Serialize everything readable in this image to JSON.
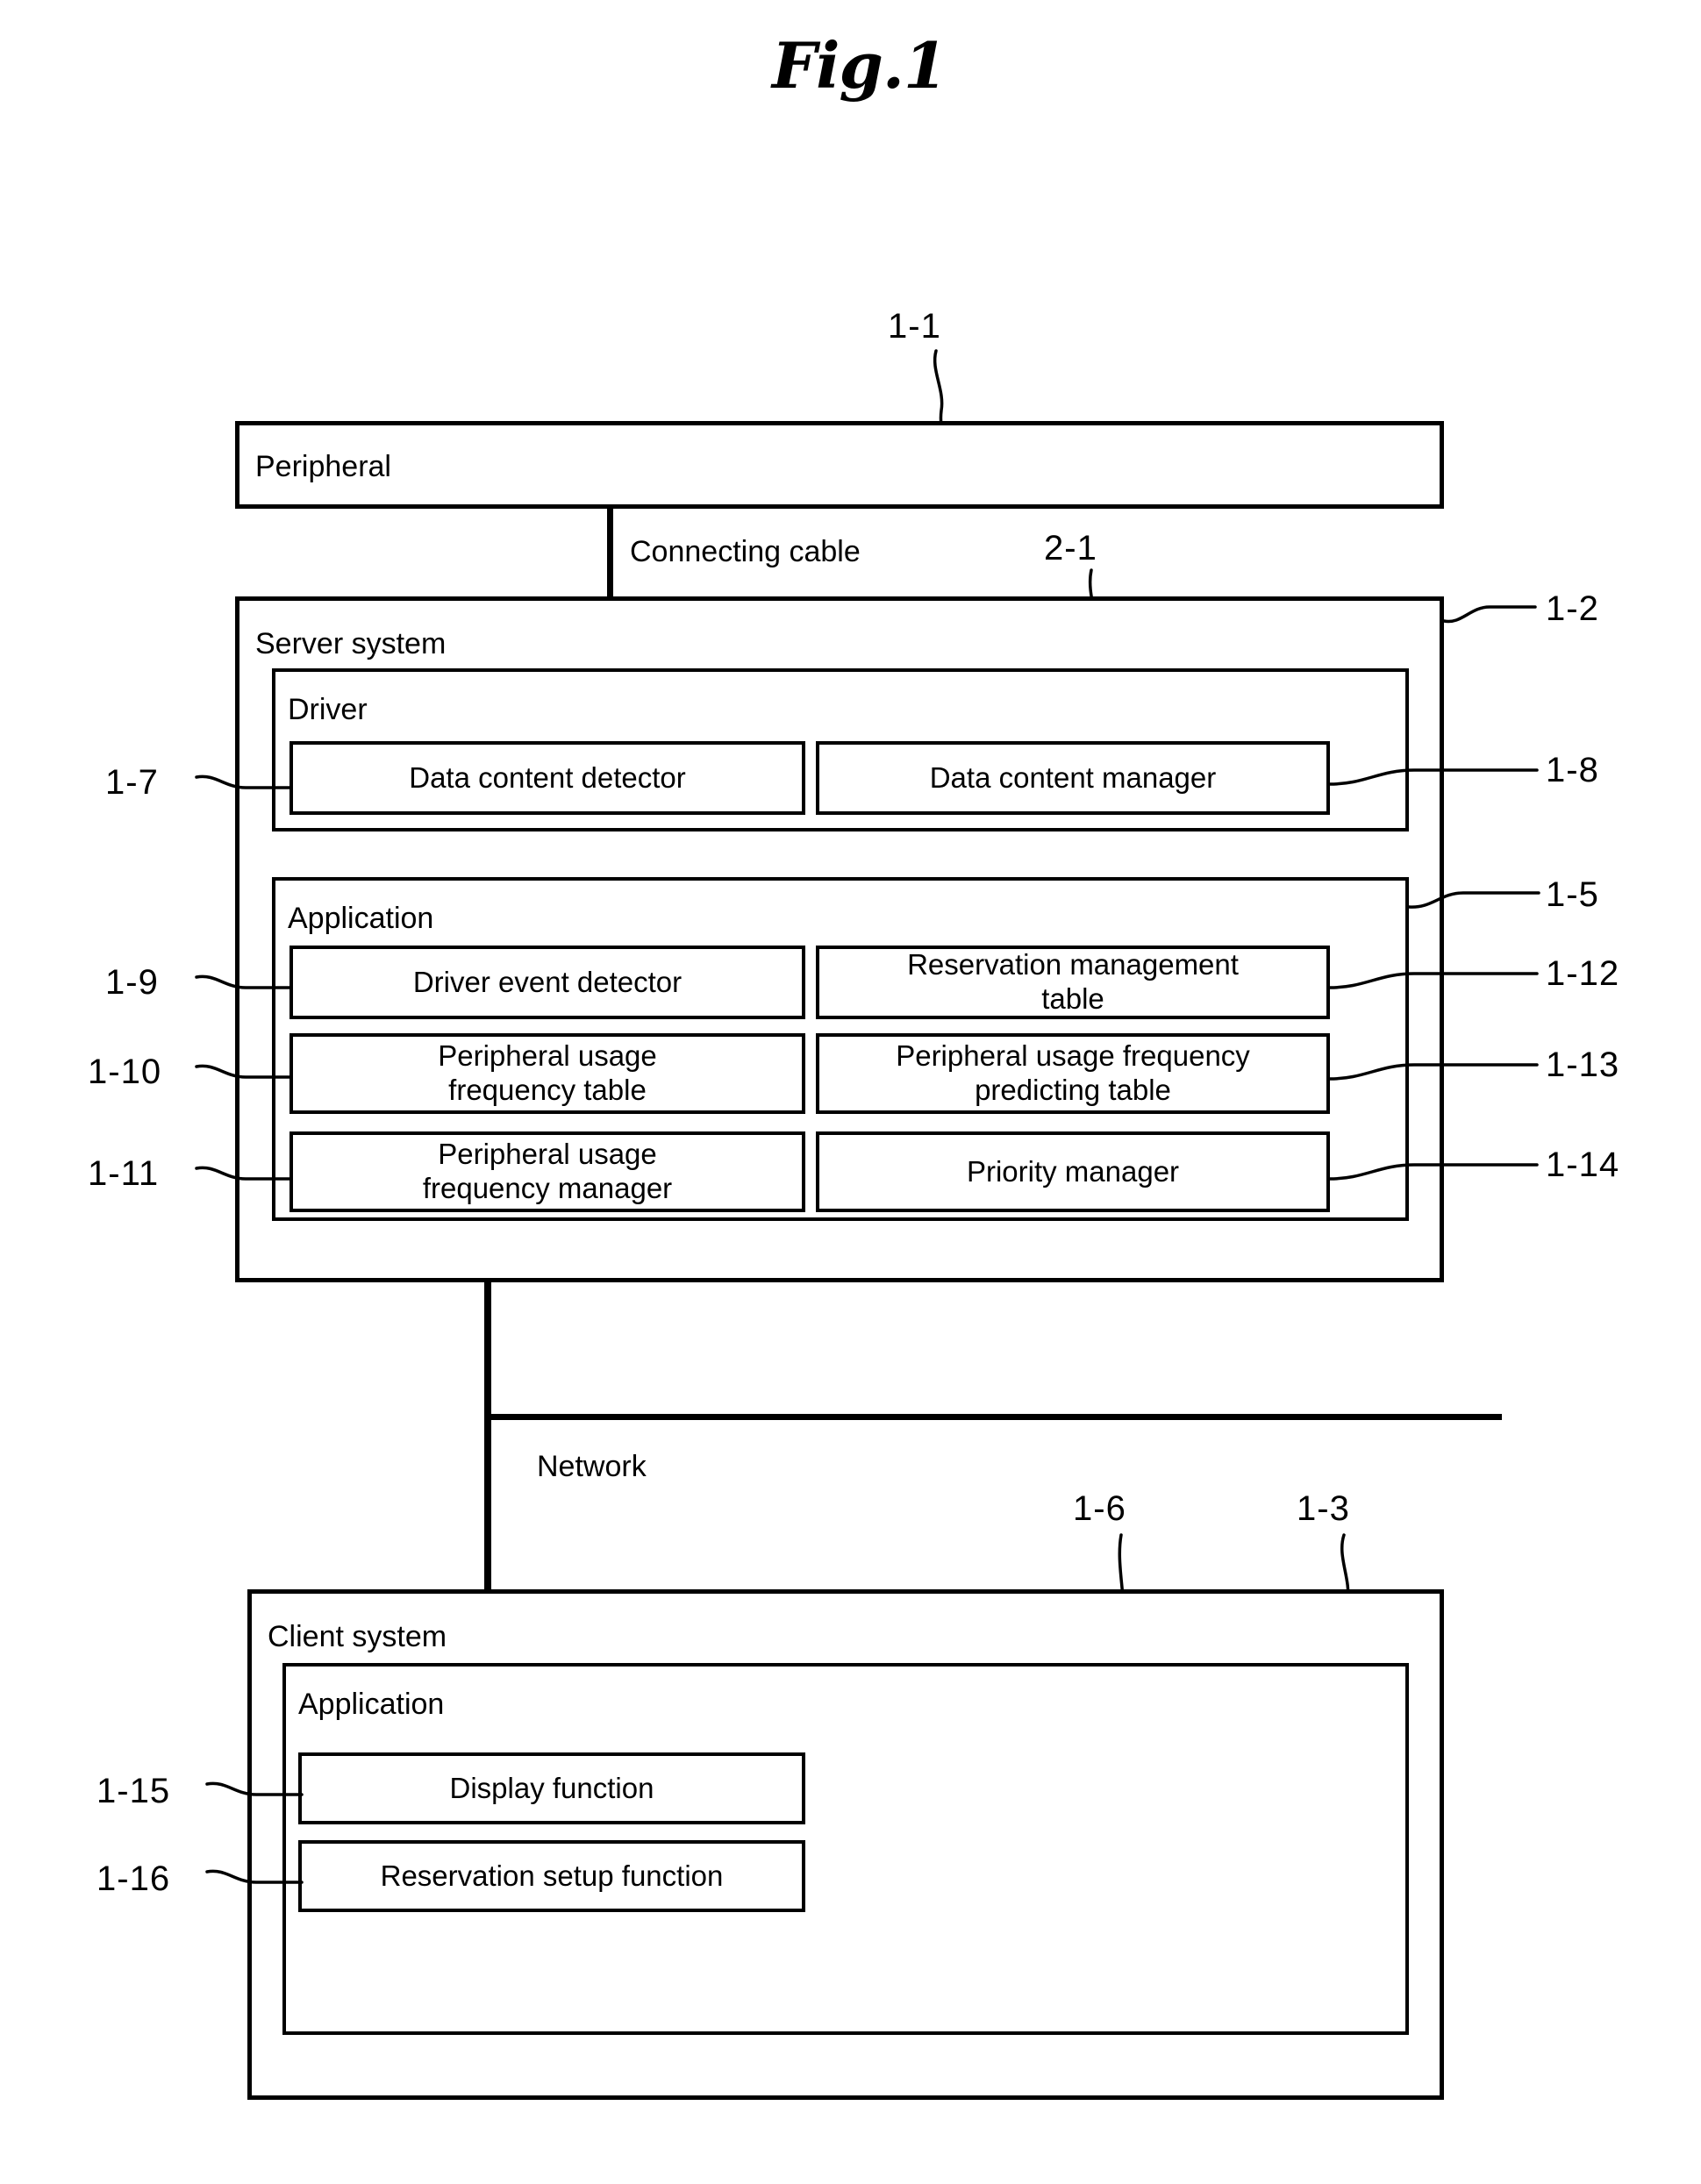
{
  "figure": {
    "title": "Fig.1"
  },
  "peripheral": {
    "label": "Peripheral",
    "ref": "1-1"
  },
  "connection": {
    "cable_label": "Connecting cable",
    "cable_ref": "2-1"
  },
  "server_system": {
    "label": "Server system",
    "ref": "1-2",
    "driver": {
      "label": "Driver",
      "modules": [
        {
          "label": "Data content detector",
          "ref": "1-7",
          "ref_side": "left"
        },
        {
          "label": "Data content manager",
          "ref": "1-8",
          "ref_side": "right"
        }
      ]
    },
    "application": {
      "label": "Application",
      "ref": "1-5",
      "modules": [
        {
          "label": "Driver event detector",
          "ref": "1-9",
          "ref_side": "left"
        },
        {
          "label": "Reservation management\ntable",
          "ref": "1-12",
          "ref_side": "right"
        },
        {
          "label": "Peripheral usage\nfrequency table",
          "ref": "1-10",
          "ref_side": "left"
        },
        {
          "label": "Peripheral usage frequency\npredicting table",
          "ref": "1-13",
          "ref_side": "right"
        },
        {
          "label": "Peripheral usage\nfrequency manager",
          "ref": "1-11",
          "ref_side": "left"
        },
        {
          "label": "Priority manager",
          "ref": "1-14",
          "ref_side": "right"
        }
      ]
    }
  },
  "network": {
    "label": "Network"
  },
  "client_system": {
    "label": "Client system",
    "ref": "1-3",
    "application": {
      "label": "Application",
      "ref": "1-6",
      "modules": [
        {
          "label": "Display function",
          "ref": "1-15",
          "ref_side": "left"
        },
        {
          "label": "Reservation setup function",
          "ref": "1-16",
          "ref_side": "left"
        }
      ]
    }
  }
}
